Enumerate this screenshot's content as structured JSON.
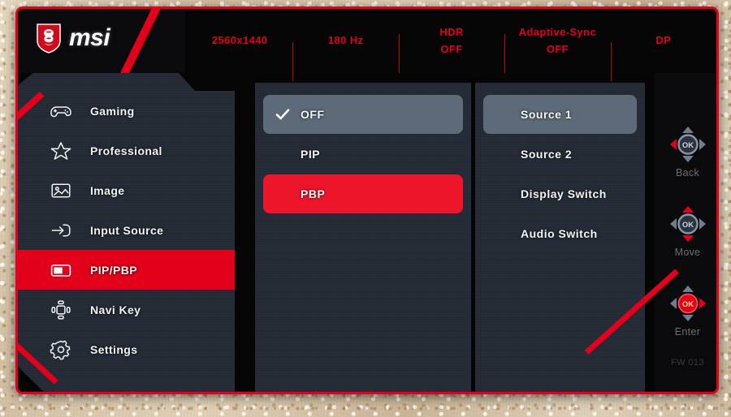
{
  "brand": {
    "name": "msi",
    "logo_icon": "msi-dragon-shield-icon"
  },
  "header": {
    "stats": [
      {
        "name": "resolution",
        "line1": "2560x1440",
        "line2": ""
      },
      {
        "name": "refresh-rate",
        "line1": "180 Hz",
        "line2": ""
      },
      {
        "name": "hdr",
        "line1": "HDR",
        "line2": "OFF"
      },
      {
        "name": "adaptive-sync",
        "line1": "Adaptive-Sync",
        "line2": "OFF"
      },
      {
        "name": "input-port",
        "line1": "DP",
        "line2": ""
      }
    ]
  },
  "sidebar": {
    "items": [
      {
        "label": "Gaming",
        "icon": "gamepad-icon",
        "active": false
      },
      {
        "label": "Professional",
        "icon": "star-icon",
        "active": false
      },
      {
        "label": "Image",
        "icon": "picture-icon",
        "active": false
      },
      {
        "label": "Input Source",
        "icon": "input-arrow-icon",
        "active": false
      },
      {
        "label": "PIP/PBP",
        "icon": "pip-pbp-icon",
        "active": true
      },
      {
        "label": "Navi Key",
        "icon": "navi-key-icon",
        "active": false
      },
      {
        "label": "Settings",
        "icon": "gear-icon",
        "active": false
      }
    ]
  },
  "column_two": {
    "options": [
      {
        "label": "OFF",
        "state": "selected",
        "checked": true
      },
      {
        "label": "PIP",
        "state": "normal",
        "checked": false
      },
      {
        "label": "PBP",
        "state": "cursor",
        "checked": false
      }
    ]
  },
  "column_three": {
    "options": [
      {
        "label": "Source  1",
        "state": "selected"
      },
      {
        "label": "Source  2",
        "state": "normal"
      },
      {
        "label": "Display Switch",
        "state": "normal"
      },
      {
        "label": "Audio Switch",
        "state": "normal"
      }
    ]
  },
  "navigation": {
    "hints": [
      {
        "label": "Back",
        "highlight": "left"
      },
      {
        "label": "Move",
        "highlight": "up-down"
      },
      {
        "label": "Enter",
        "highlight": "center-right"
      }
    ],
    "firmware": "FW 013"
  },
  "colors": {
    "accent_red": "#e3001b",
    "cursor_red": "#ec1529",
    "panel": "#242b36",
    "selected_gray": "#5c6a79",
    "black": "#050506",
    "text": "#f2f2f2",
    "muted": "#6e6e72"
  }
}
